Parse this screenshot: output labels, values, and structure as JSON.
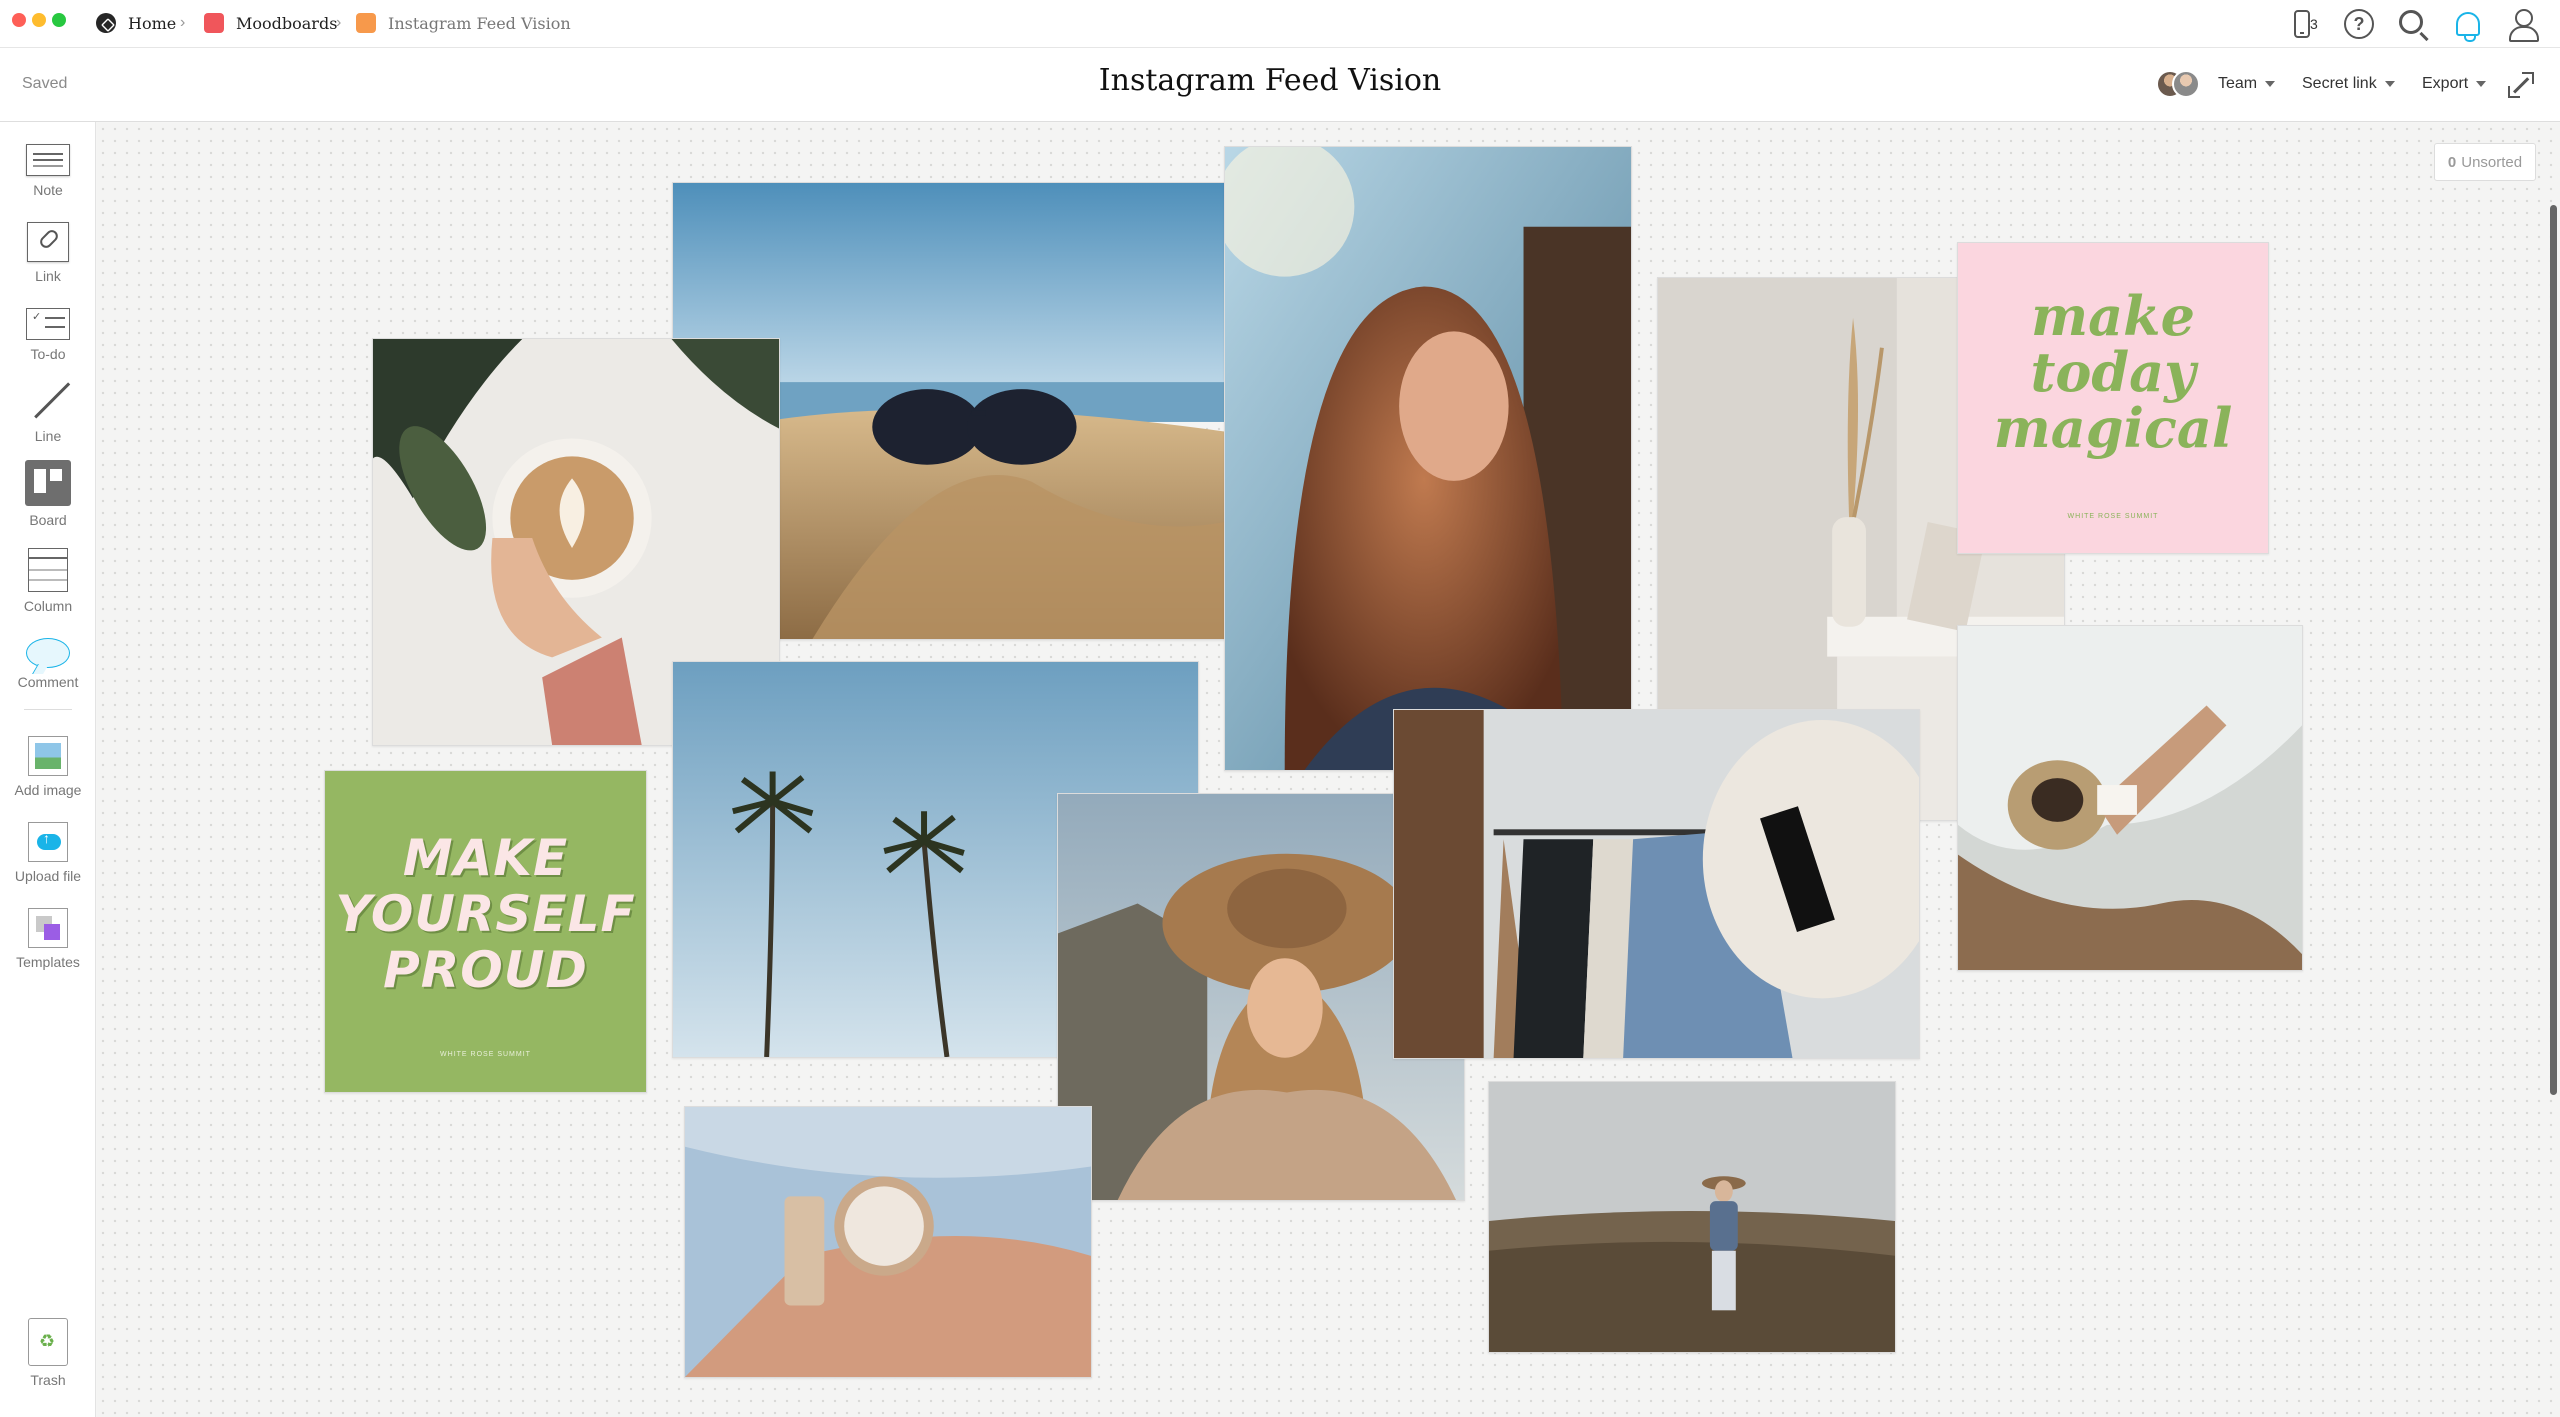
{
  "window": {
    "breadcrumbs": [
      {
        "label": "Home"
      },
      {
        "label": "Moodboards"
      },
      {
        "label": "Instagram Feed Vision"
      }
    ],
    "device_count": "3"
  },
  "header": {
    "saved_status": "Saved",
    "title": "Instagram Feed Vision",
    "team_label": "Team",
    "secret_link_label": "Secret link",
    "export_label": "Export"
  },
  "toolbar": {
    "items": [
      {
        "label": "Note"
      },
      {
        "label": "Link"
      },
      {
        "label": "To-do"
      },
      {
        "label": "Line"
      },
      {
        "label": "Board"
      },
      {
        "label": "Column"
      },
      {
        "label": "Comment"
      },
      {
        "label": "Add image"
      },
      {
        "label": "Upload file"
      },
      {
        "label": "Templates"
      }
    ],
    "trash_label": "Trash"
  },
  "canvas": {
    "unsorted_count": "0",
    "unsorted_label": "Unsorted",
    "pink_quote": {
      "line1": "make",
      "line2": "today",
      "line3": "magical",
      "signature": "WHITE ROSE SUMMIT"
    },
    "green_quote": {
      "line1": "MAKE",
      "line2": "YOURSELF",
      "line3": "PROUD",
      "signature": "WHITE ROSE SUMMIT"
    }
  },
  "colors": {
    "accent_blue": "#1ab4e8",
    "pink_card": "#fbd6df",
    "green_card": "#95b762",
    "close": "#fe5f57",
    "minimize": "#febc2e",
    "maximize": "#28c840"
  }
}
